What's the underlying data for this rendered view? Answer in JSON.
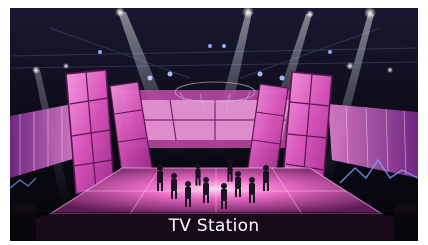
{
  "caption": {
    "text": "TV Station"
  },
  "colors": {
    "background": "#0b0a16",
    "panel_pink": "#e870c8",
    "panel_deep": "#b0319a",
    "floor_glow": "#d44fae",
    "beam": "#dfe8ff"
  }
}
